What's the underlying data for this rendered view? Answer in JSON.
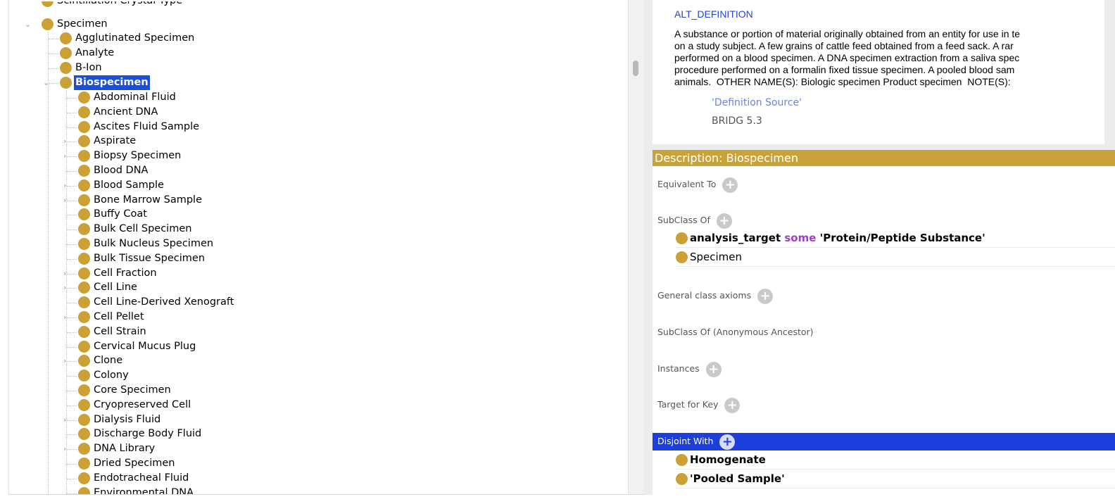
{
  "tree": {
    "top_partial": "Scintillation Crystal Type",
    "specimen": "Specimen",
    "specimen_children": [
      "Agglutinated Specimen",
      "Analyte",
      "B-Ion"
    ],
    "biospecimen": "Biospecimen",
    "biospecimen_children": [
      {
        "label": "Abdominal Fluid",
        "expandable": false
      },
      {
        "label": "Ancient DNA",
        "expandable": false
      },
      {
        "label": "Ascites Fluid Sample",
        "expandable": false
      },
      {
        "label": "Aspirate",
        "expandable": true
      },
      {
        "label": "Biopsy Specimen",
        "expandable": true
      },
      {
        "label": "Blood DNA",
        "expandable": false
      },
      {
        "label": "Blood Sample",
        "expandable": true
      },
      {
        "label": "Bone Marrow Sample",
        "expandable": true
      },
      {
        "label": "Buffy Coat",
        "expandable": false
      },
      {
        "label": "Bulk Cell Specimen",
        "expandable": false
      },
      {
        "label": "Bulk Nucleus Specimen",
        "expandable": false
      },
      {
        "label": "Bulk Tissue Specimen",
        "expandable": false
      },
      {
        "label": "Cell Fraction",
        "expandable": true
      },
      {
        "label": "Cell Line",
        "expandable": true
      },
      {
        "label": "Cell Line-Derived Xenograft",
        "expandable": false
      },
      {
        "label": "Cell Pellet",
        "expandable": true
      },
      {
        "label": "Cell Strain",
        "expandable": false
      },
      {
        "label": "Cervical Mucus Plug",
        "expandable": false
      },
      {
        "label": "Clone",
        "expandable": true
      },
      {
        "label": "Colony",
        "expandable": false
      },
      {
        "label": "Core Specimen",
        "expandable": false
      },
      {
        "label": "Cryopreserved Cell",
        "expandable": false
      },
      {
        "label": "Dialysis Fluid",
        "expandable": true
      },
      {
        "label": "Discharge Body Fluid",
        "expandable": false
      },
      {
        "label": "DNA Library",
        "expandable": true
      },
      {
        "label": "Dried Specimen",
        "expandable": false
      },
      {
        "label": "Endotracheal Fluid",
        "expandable": false
      },
      {
        "label": "Environmental DNA",
        "expandable": false
      }
    ]
  },
  "annotation": {
    "title": "ALT_DEFINITION",
    "body": "A substance or portion of material originally obtained from an entity for use in te\non a study subject. A few grains of cattle feed obtained from a feed sack. A rar\nperformed on a blood specimen. A DNA specimen extraction from a saliva spec\nprocedure performed on a formalin fixed tissue specimen. A pooled blood sam\nanimals.  OTHER NAME(S): Biologic specimen Product specimen  NOTE(S):",
    "sub_label": "'Definition Source'",
    "sub_value": "BRIDG 5.3"
  },
  "description": {
    "header": "Description: Biospecimen",
    "sections": {
      "equivalent_to": "Equivalent To",
      "subclass_of": "SubClass Of",
      "general_axioms": "General class axioms",
      "anon_ancestor": "SubClass Of (Anonymous Ancestor)",
      "instances": "Instances",
      "target_for_key": "Target for Key",
      "disjoint_with": "Disjoint With"
    },
    "subclass_rows": {
      "row1_prop": "analysis_target",
      "row1_kw": "some",
      "row1_value": "'Protein/Peptide Substance'",
      "row2": "Specimen"
    },
    "disjoint_rows": [
      "Homogenate",
      "'Pooled Sample'"
    ],
    "plus_symbol": "+"
  },
  "colors": {
    "class_dot": "#cba135",
    "header_bar": "#c8a33a",
    "selection": "#1a4fd6",
    "keyword": "#a23fbf",
    "annotation_title": "#2446d0"
  }
}
